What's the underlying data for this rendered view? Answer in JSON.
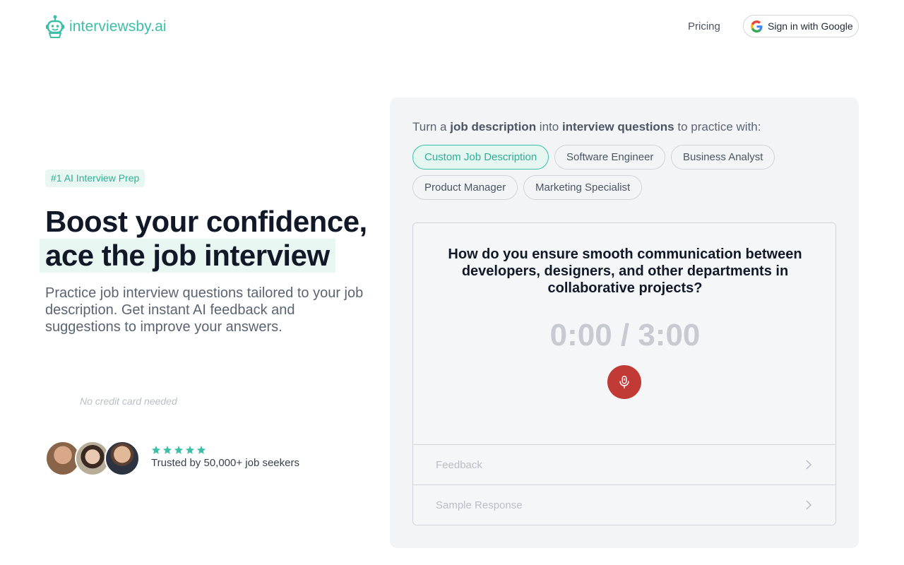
{
  "header": {
    "logo_text": "interviewsby.ai",
    "logo_icon": "robot-icon",
    "pricing_label": "Pricing",
    "google_signin_label": "Sign in with Google",
    "google_icon": "google-g-icon"
  },
  "hero": {
    "badge": "#1 AI Interview Prep",
    "title_line1": "Boost your confidence,",
    "title_line2": "ace the job interview",
    "subtitle": "Practice job interview questions tailored to your job description. Get instant AI feedback and suggestions to improve your answers.",
    "no_credit_card": "No credit card needed",
    "rating_stars": 5,
    "trust_text": "Trusted by 50,000+ job seekers"
  },
  "practice": {
    "intro_prefix": "Turn a ",
    "intro_bold1": "job description",
    "intro_mid": " into ",
    "intro_bold2": "interview questions",
    "intro_suffix": " to practice with:",
    "chips": [
      {
        "label": "Custom Job Description",
        "active": true
      },
      {
        "label": "Software Engineer",
        "active": false
      },
      {
        "label": "Business Analyst",
        "active": false
      },
      {
        "label": "Product Manager",
        "active": false
      },
      {
        "label": "Marketing Specialist",
        "active": false
      }
    ],
    "question": "How do you ensure smooth communication between developers, designers, and other departments in collaborative projects?",
    "timer": "0:00 / 3:00",
    "mic_icon": "microphone-icon",
    "feedback_label": "Feedback",
    "sample_response_label": "Sample Response"
  },
  "colors": {
    "brand": "#3cbfa6",
    "badge_bg": "#e9f7f3",
    "mic_red": "#c23a36",
    "star": "#3cbfa6"
  }
}
